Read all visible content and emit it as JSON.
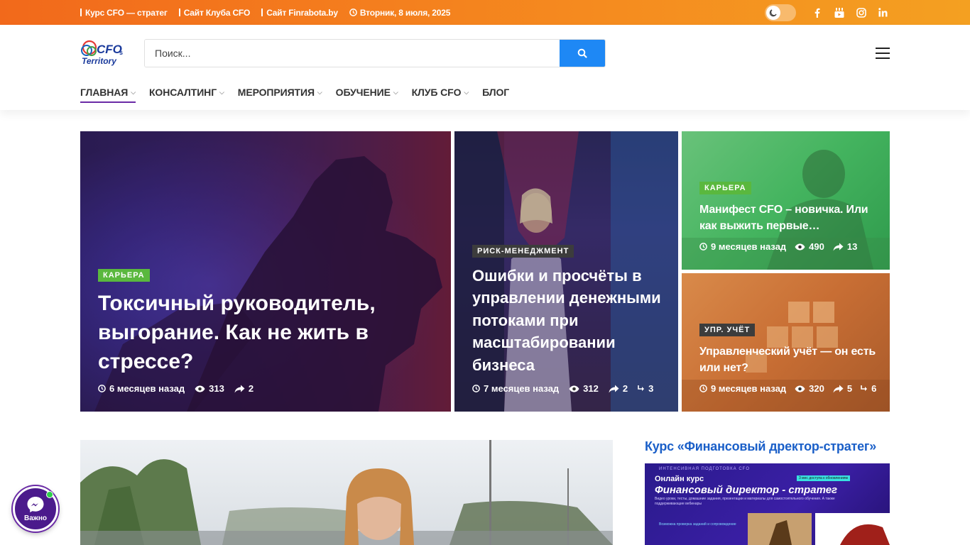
{
  "topbar": {
    "links": [
      "Курс CFO — стратег",
      "Сайт Клуба CFO",
      "Сайт Finrabota.by"
    ],
    "date": "Вторник, 8 июля, 2025",
    "social_icons": [
      "moon-icon",
      "facebook-icon",
      "youtube-icon",
      "instagram-icon",
      "linkedin-icon"
    ]
  },
  "header": {
    "logo_text_top": "CFO",
    "logo_text_sub": "s",
    "logo_text_bottom": "Territory",
    "search_placeholder": "Поиск...",
    "nav": [
      {
        "label": "ГЛАВНАЯ",
        "active": true,
        "has_dropdown": true
      },
      {
        "label": "КОНСАЛТИНГ",
        "has_dropdown": true
      },
      {
        "label": "МЕРОПРИЯТИЯ",
        "has_dropdown": true
      },
      {
        "label": "ОБУЧЕНИЕ",
        "has_dropdown": true
      },
      {
        "label": "КЛУБ CFO",
        "has_dropdown": true
      },
      {
        "label": "БЛОГ",
        "has_dropdown": false
      }
    ]
  },
  "featured": [
    {
      "category": "КАРЬЕРА",
      "title": "Токсичный руководитель, выгорание. Как не жить в стрессе?",
      "time": "6 месяцев назад",
      "views": "313",
      "shares": "2"
    },
    {
      "category": "РИСК-МЕНЕДЖМЕНТ",
      "title": "Ошибки и просчёты в управлении денежными потоками при масштабировании бизнеса",
      "time": "7 месяцев назад",
      "views": "312",
      "shares": "2",
      "comments": "3"
    },
    {
      "category": "КАРЬЕРА",
      "title": "Манифест CFO – новичка. Или как выжить первые…",
      "time": "9 месяцев назад",
      "views": "490",
      "shares": "13"
    },
    {
      "category": "УПР. УЧЁТ",
      "title": "Управленческий учёт — он есть или нет?",
      "time": "9 месяцев назад",
      "views": "320",
      "shares": "5",
      "comments": "6"
    }
  ],
  "sidebar": {
    "title": "Курс «Финансовый дректор-стратег»",
    "banner": {
      "kicker": "ИНТЕНСИВНАЯ ПОДГОТОВКА CFO",
      "line1": "Онлайн курс",
      "line2": "Финансовый директор - стратег",
      "desc": "Видео уроки, тесты, домашние задания, презентации и материалы для самостоятельного обучения. А также поддерживающие вебинары",
      "badge": "3 мес доступа к обновлениям",
      "footer": "Возможна проверка заданий и сопровождение"
    }
  },
  "chat": {
    "label": "Важно"
  },
  "colors": {
    "accent_orange": "#f2691b",
    "accent_blue": "#1e88f5",
    "category_green": "#5ab83e",
    "nav_active": "#6a2aa6",
    "sidebar_title": "#1a5fc8"
  }
}
